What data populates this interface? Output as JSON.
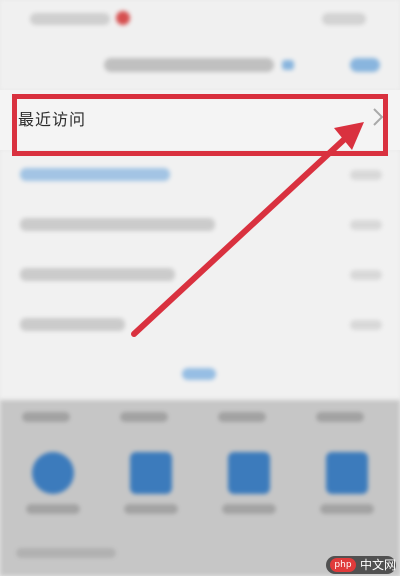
{
  "recent_visits": {
    "label": "最近访问"
  },
  "annotation": {
    "highlight_color": "#d9313f",
    "arrow_color": "#d9313f"
  },
  "watermark": {
    "logo": "php",
    "text": "中文网"
  }
}
